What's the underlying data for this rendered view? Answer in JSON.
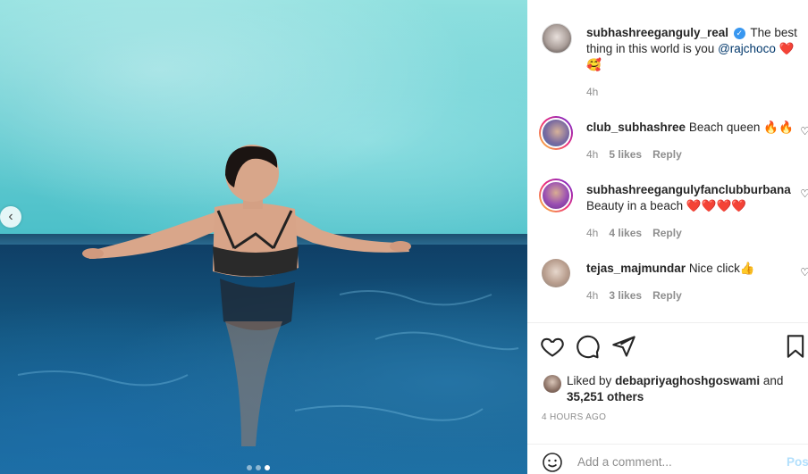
{
  "post": {
    "author": "subhashreeganguly_real",
    "caption_text": "The best thing in this world is you",
    "mention": "@rajchoco",
    "caption_emoji": "❤️ 🥰",
    "time": "4h"
  },
  "comments": [
    {
      "username": "club_subhashree",
      "text": "Beach queen 🔥🔥",
      "time": "4h",
      "likes": "5 likes",
      "reply": "Reply"
    },
    {
      "username": "subhashreegangulyfanclubburbana",
      "text": "Beauty in a beach ❤️❤️❤️❤️",
      "time": "4h",
      "likes": "4 likes",
      "reply": "Reply"
    },
    {
      "username": "tejas_majmundar",
      "text": "Nice click👍",
      "time": "4h",
      "likes": "3 likes",
      "reply": "Reply"
    }
  ],
  "likes": {
    "prefix": "Liked by",
    "user": "debapriyaghoshgoswami",
    "and": "and",
    "count": "35,251 others"
  },
  "timestamp": "4 HOURS AGO",
  "add_comment": {
    "placeholder": "Add a comment...",
    "post_label": "Post"
  },
  "icons": [
    "heart-icon",
    "comment-icon",
    "share-icon",
    "bookmark-icon",
    "emoji-icon",
    "chevron-left-icon"
  ],
  "carousel": {
    "count": 3,
    "active": 3
  }
}
